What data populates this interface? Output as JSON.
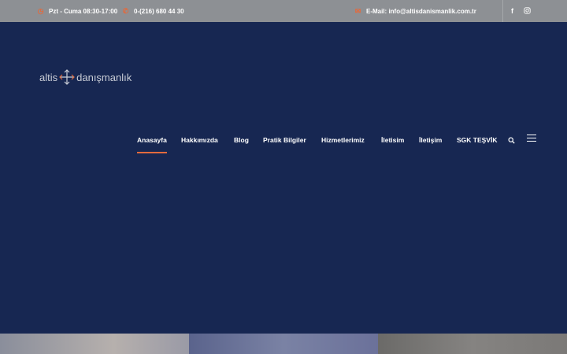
{
  "topbar": {
    "hours": "Pzt - Cuma 08:30-17:00",
    "phone": "0-(216) 680 44 30",
    "email": "E-Mail: info@altisdanismanlik.com.tr",
    "social": [
      "facebook-icon",
      "instagram-icon"
    ]
  },
  "logo": {
    "left_text": "altis",
    "right_text": "danışmanlık"
  },
  "nav": {
    "items": [
      "Anasayfa",
      "Hakkımızda",
      "Blog",
      "Pratik Bilgiler",
      "Hizmetlerimiz",
      "İletisim",
      "İletişim",
      "SGK TEŞVİK"
    ],
    "active": "Anasayfa"
  },
  "colors": {
    "accent": "#e36a3d",
    "header_bg": "#172752",
    "topbar_bg": "#8d9094"
  }
}
